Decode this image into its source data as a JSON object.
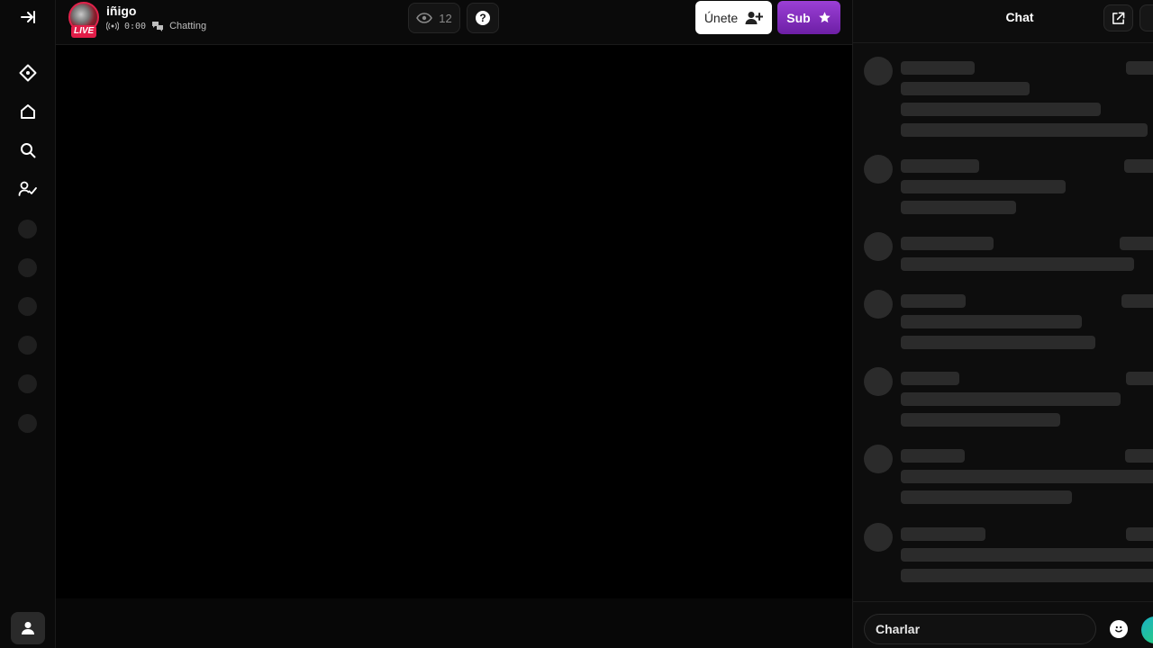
{
  "colors": {
    "live": "#e11d48",
    "sub": "#8b2fc9",
    "skeleton": "#2b2b2b",
    "background": "#0a0a0a"
  },
  "sidebar": {
    "items": [
      {
        "name": "collapse",
        "icon": "collapse-arrow-icon"
      },
      {
        "name": "discover",
        "icon": "compass-diamond-icon"
      },
      {
        "name": "home",
        "icon": "home-icon"
      },
      {
        "name": "search",
        "icon": "search-icon"
      },
      {
        "name": "following",
        "icon": "user-check-icon"
      }
    ],
    "placeholder_count": 6,
    "profile_icon": "user-icon"
  },
  "header": {
    "streamer_name": "iñigo",
    "live_badge": "LIVE",
    "uptime": "0:00",
    "category": "Chatting",
    "viewer_count": "12",
    "help_label": "?",
    "join_label": "Únete",
    "sub_label": "Sub"
  },
  "chat": {
    "title": "Chat",
    "input_placeholder": "Charlar",
    "popout_icon": "external-link-icon",
    "emoji_icon": "smiley-icon"
  }
}
